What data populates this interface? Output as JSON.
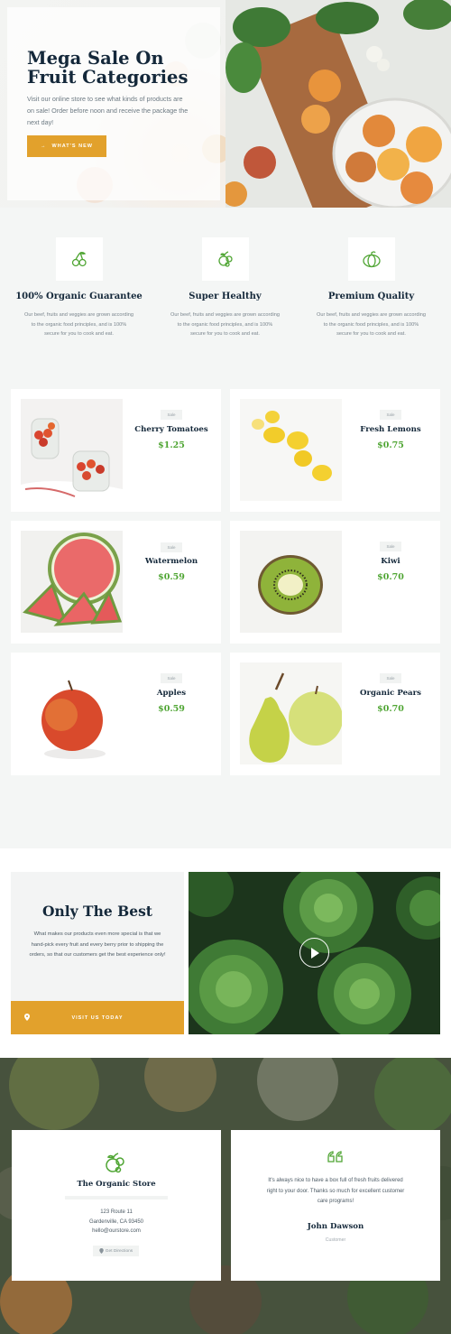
{
  "hero": {
    "title": "Mega Sale On Fruit Categories",
    "text": "Visit our online store to see what kinds of products are on sale! Order before noon and receive the package the next day!",
    "button_label": "WHAT'S NEW",
    "button_arrow": "→"
  },
  "features": [
    {
      "title": "100% Organic Guarantee",
      "text": "Our beef, fruits and veggies are grown according to the organic food principles, and is 100% secure for you to cook and eat.",
      "icon": "cherries-icon"
    },
    {
      "title": "Super Healthy",
      "text": "Our beef, fruits and veggies are grown according to the organic food principles, and is 100% secure for you to cook and eat.",
      "icon": "mixed-fruit-icon"
    },
    {
      "title": "Premium Quality",
      "text": "Our beef, fruits and veggies are grown according to the organic food principles, and is 100% secure for you to cook and eat.",
      "icon": "pumpkin-icon"
    }
  ],
  "products": [
    {
      "badge": "Sale",
      "name": "Cherry Tomatoes",
      "price": "$1.25"
    },
    {
      "badge": "Sale",
      "name": "Fresh Lemons",
      "price": "$0.75"
    },
    {
      "badge": "Sale",
      "name": "Watermelon",
      "price": "$0.59"
    },
    {
      "badge": "Sale",
      "name": "Kiwi",
      "price": "$0.70"
    },
    {
      "badge": "Sale",
      "name": "Apples",
      "price": "$0.59"
    },
    {
      "badge": "Sale",
      "name": "Organic Pears",
      "price": "$0.70"
    }
  ],
  "best": {
    "title": "Only The Best",
    "text": "What makes our products even more special is that we hand-pick every fruit and every berry prior to shipping the orders, so that our customers get the best experience only!",
    "button_label": "VISIT US TODAY"
  },
  "store": {
    "name": "The Organic Store",
    "address1": "123 Route 11",
    "address2": "Gardenville, CA 93450",
    "email": "hello@ourstore.com",
    "directions_label": "Get Directions"
  },
  "testimonial": {
    "text": "It's always nice to have a box full of fresh fruits delivered right to your door. Thanks so much for excellent customer care programs!",
    "name": "John Dawson",
    "role": "Customer"
  },
  "colors": {
    "accent": "#e2a12c",
    "price": "#4fa533",
    "heading": "#14283a",
    "icon": "#4fa533"
  }
}
